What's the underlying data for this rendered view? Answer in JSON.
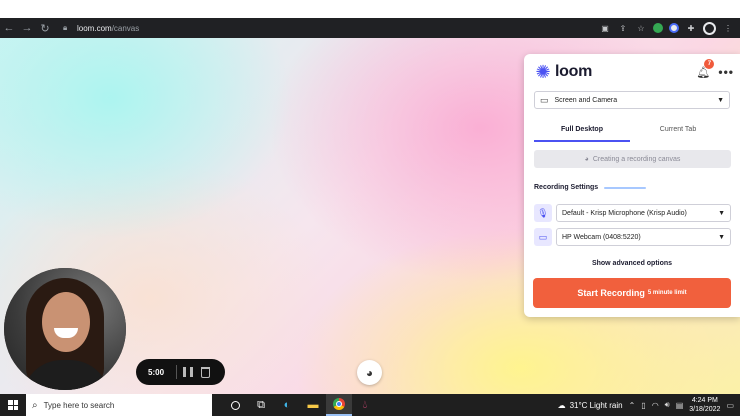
{
  "browser": {
    "url_host": "loom.com",
    "url_path": "/canvas",
    "icons": [
      "back-icon",
      "forward-icon",
      "reload-icon",
      "lock-icon",
      "camera-icon",
      "share-icon",
      "star-icon",
      "extension-grammarly-icon",
      "extension-loom-icon",
      "puzzle-icon",
      "profile-icon",
      "menu-icon"
    ]
  },
  "recording_controls": {
    "timer": "5:00",
    "icons": [
      "pause-icon",
      "trash-icon"
    ]
  },
  "canvas": {
    "palette_icon": "palette-icon"
  },
  "loom_panel": {
    "logo_text": "loom",
    "notification_count": "7",
    "more_label": "•••",
    "mode_select": "Screen and Camera",
    "tabs": [
      {
        "label": "Full Desktop",
        "active": true
      },
      {
        "label": "Current Tab",
        "active": false
      }
    ],
    "status_text": "Creating a recording canvas",
    "recording_settings_title": "Recording Settings",
    "microphone": "Default - Krisp Microphone (Krisp Audio)",
    "camera": "HP Webcam (0408:5220)",
    "advanced_label": "Show advanced options",
    "start_button": "Start Recording",
    "start_button_sub": "5 minute limit",
    "accent_color": "#4b52f2",
    "start_color": "#f1603d"
  },
  "taskbar": {
    "search_placeholder": "Type here to search",
    "apps": [
      {
        "name": "task-view",
        "active": false
      },
      {
        "name": "edge",
        "active": false
      },
      {
        "name": "file-explorer",
        "active": false
      },
      {
        "name": "chrome",
        "active": true
      },
      {
        "name": "drop-app",
        "active": false
      }
    ],
    "weather": "31°C  Light rain",
    "time": "4:24 PM",
    "date": "3/18/2022"
  }
}
